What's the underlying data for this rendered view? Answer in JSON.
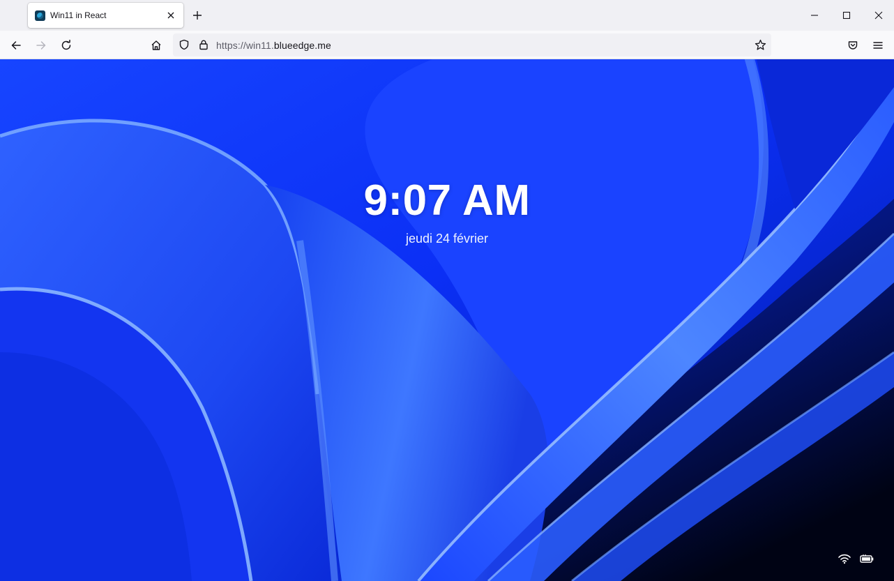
{
  "browser": {
    "tab": {
      "title": "Win11 in React",
      "favicon": "react-app-icon",
      "close_icon": "close-icon"
    },
    "new_tab_icon": "plus-icon",
    "window_controls": [
      "minimize-icon",
      "maximize-icon",
      "close-icon"
    ],
    "nav": {
      "back_icon": "arrow-left-icon",
      "forward_icon": "arrow-right-icon",
      "reload_icon": "reload-icon",
      "home_icon": "home-icon"
    },
    "url": {
      "scheme": "https://win11.",
      "host": "blueedge.me"
    },
    "url_icons": [
      "shield-icon",
      "lock-icon",
      "star-icon"
    ],
    "toolbar_icons": [
      "pocket-icon",
      "menu-icon"
    ]
  },
  "lockscreen": {
    "time": "9:07 AM",
    "date": "jeudi 24 février",
    "tray_icons": [
      "wifi-icon",
      "battery-icon"
    ]
  },
  "colors": {
    "wallpaper_base": "#0b2ff5",
    "wallpaper_light": "#5d97ff",
    "wallpaper_dark": "#000826"
  }
}
